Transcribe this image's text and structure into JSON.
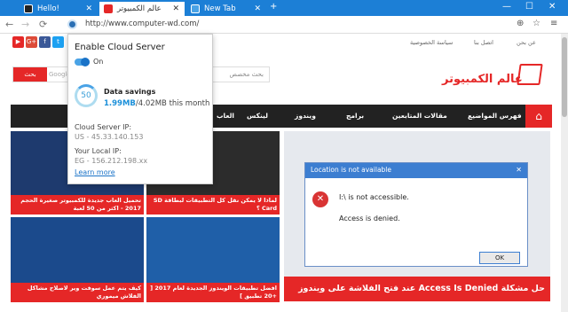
{
  "tabs": [
    {
      "title": "Hello!",
      "active": false
    },
    {
      "title": "عالم الكمبيوتر",
      "active": true
    },
    {
      "title": "New Tab",
      "active": false
    }
  ],
  "address_url": "http://www.computer-wd.com/",
  "colors": {
    "tabbar": "#1c7fd6",
    "brand_red": "#e52727",
    "menu_dark": "#222222",
    "accent_blue": "#1a73c8"
  },
  "site": {
    "top_links": [
      "اتصل بنا",
      "سياسة الخصوصية"
    ],
    "top_right": "عن بحن",
    "search_button": "بحث",
    "search_google": "Google",
    "search_placeholder": "بحث مخصص",
    "logo_text": "عالم الكمبيوتر",
    "menu_items": [
      "فهرس المواضيع",
      "مقالات المتابعين",
      "برامج",
      "ويندوز",
      "لينكس",
      "العاب"
    ],
    "cards": [
      {
        "caption": "لماذا لا يمكن نقل كل التطبيقات لبطاقة SD Card ؟"
      },
      {
        "caption": "تحميل العاب جديدة للكمبيوتر صغيرة الحجم 2017 - اكثر من 50 لعبة"
      },
      {
        "caption": "افضل تطبيقات الويندوز الجديدة لعام 2017 [ +20 تطبيق ]"
      },
      {
        "caption": "كيف يتم عمل سوفت وير لاصلاح مشاكل الفلاش ميموري"
      }
    ],
    "featured_caption": "حل مشكلة Access Is Denied عند فتح الفلاشة على ويندوز",
    "dialog": {
      "title": "Location is not available",
      "message1": "I:\\ is not accessible.",
      "message2": "Access is denied.",
      "ok": "OK"
    }
  },
  "popup": {
    "title": "Enable Cloud Server",
    "toggle_state": "On",
    "savings_percent": "50",
    "savings_label": "Data savings",
    "saved_mb": "1.99MB",
    "total_mb": "/4.02MB this month",
    "cloud_ip_label": "Cloud Server IP:",
    "cloud_ip": "US - 45.33.140.153",
    "local_ip_label": "Your Local IP:",
    "local_ip": "EG - 156.212.198.xx",
    "learn_more": "Learn more"
  }
}
